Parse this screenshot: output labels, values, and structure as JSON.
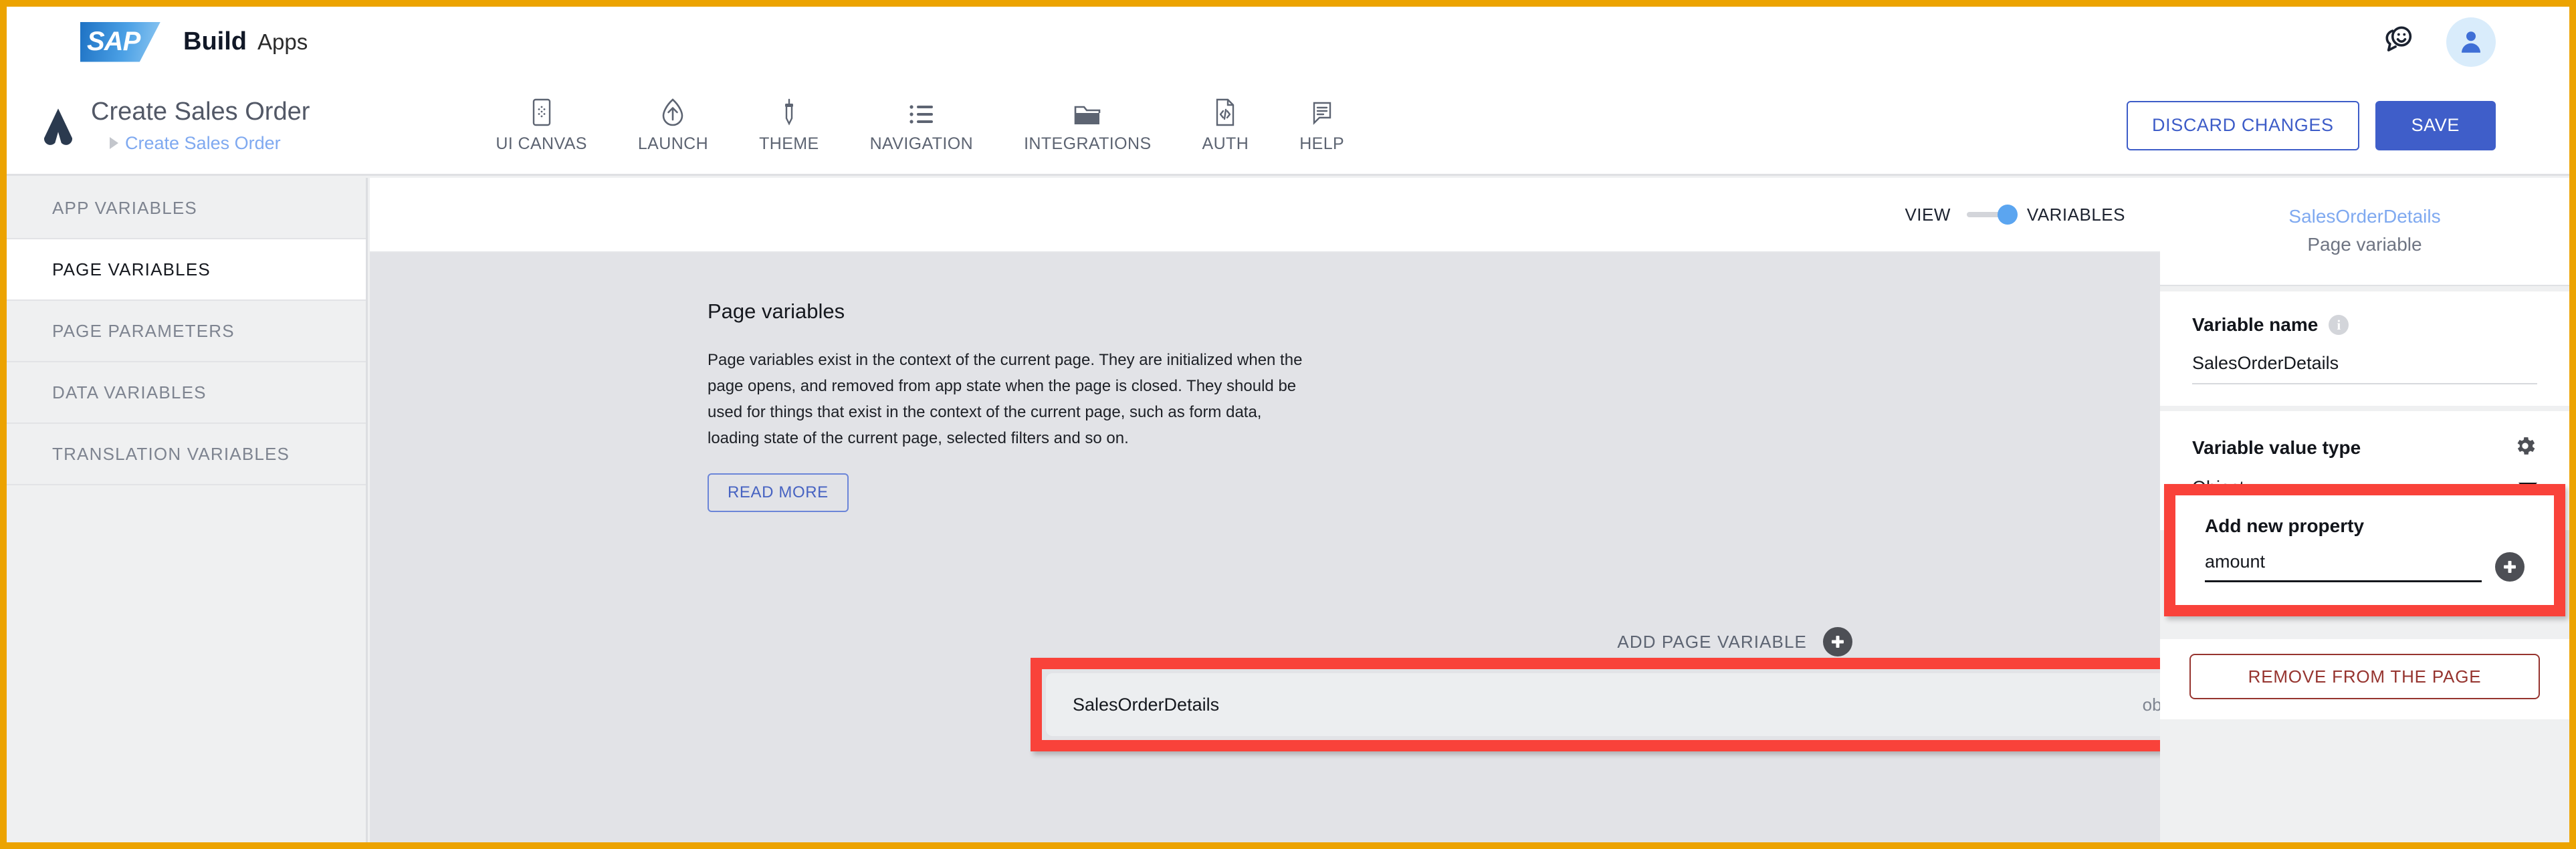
{
  "topbar": {
    "logo_text": "SAP",
    "brand_primary": "Build",
    "brand_secondary": "Apps",
    "feedback_icon": "chat-smiley-icon",
    "avatar_icon": "user-avatar-icon"
  },
  "header": {
    "app_icon": "app-chevron-icon",
    "app_title": "Create Sales Order",
    "breadcrumb_label": "Create Sales Order",
    "nav": [
      {
        "label": "UI CANVAS",
        "icon": "device-canvas-icon"
      },
      {
        "label": "LAUNCH",
        "icon": "launch-arrow-icon"
      },
      {
        "label": "THEME",
        "icon": "eyedropper-icon"
      },
      {
        "label": "NAVIGATION",
        "icon": "list-icon"
      },
      {
        "label": "INTEGRATIONS",
        "icon": "folder-icon"
      },
      {
        "label": "AUTH",
        "icon": "code-file-icon"
      },
      {
        "label": "HELP",
        "icon": "comment-lines-icon"
      }
    ],
    "discard_label": "DISCARD CHANGES",
    "save_label": "SAVE"
  },
  "sidebar": {
    "items": [
      {
        "label": "APP VARIABLES",
        "active": false
      },
      {
        "label": "PAGE VARIABLES",
        "active": true
      },
      {
        "label": "PAGE PARAMETERS",
        "active": false
      },
      {
        "label": "DATA VARIABLES",
        "active": false
      },
      {
        "label": "TRANSLATION VARIABLES",
        "active": false
      }
    ]
  },
  "content": {
    "toggle_left_label": "VIEW",
    "toggle_right_label": "VARIABLES",
    "title": "Page variables",
    "description": "Page variables exist in the context of the current page. They are initialized when the page opens, and removed from app state when the page is closed. They should be used for things that exist in the context of the current page, such as form data, loading state of the current page, selected filters and so on.",
    "read_more_label": "READ MORE",
    "add_variable_label": "ADD PAGE VARIABLE",
    "add_variable_icon": "plus-circle-icon",
    "variables": [
      {
        "name": "SalesOrderDetails",
        "type": "object"
      }
    ]
  },
  "right_panel": {
    "variable_name_heading": "SalesOrderDetails",
    "variable_kind": "Page variable",
    "variable_name_label": "Variable name",
    "variable_name_info_icon": "info-icon",
    "variable_name_value": "SalesOrderDetails",
    "variable_value_type_label": "Variable value type",
    "variable_value_type_gear_icon": "gear-icon",
    "variable_value_type_value": "Object",
    "value_type_caret_icon": "chevron-down-icon",
    "add_new_property_label": "Add new property",
    "add_new_property_value": "amount",
    "add_new_property_icon": "plus-circle-icon",
    "remove_label": "REMOVE FROM THE PAGE"
  },
  "colors": {
    "frame_border": "#ECA301",
    "highlight": "#f9423a",
    "accent_blue": "#3f5ec9",
    "link_blue": "#7fa9f0",
    "toggle_knob": "#5ba5f0",
    "danger_red": "#96342f",
    "content_bg": "#e2e3e7",
    "sidebar_bg": "#eff0f1"
  }
}
